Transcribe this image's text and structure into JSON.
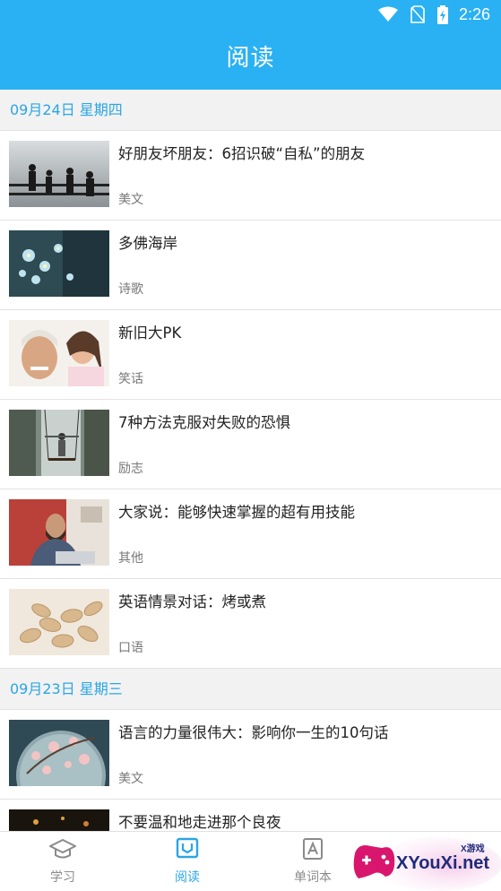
{
  "status_bar": {
    "time": "2:26",
    "icons": [
      "wifi-icon",
      "no-sim-icon",
      "battery-charging-icon"
    ]
  },
  "header": {
    "title": "阅读"
  },
  "sections": [
    {
      "date": "09月24日 星期四",
      "items": [
        {
          "title": "好朋友坏朋友：6招识破“自私”的朋友",
          "category": "美文",
          "thumb": "friends-silhouette-image"
        },
        {
          "title": "多佛海岸",
          "category": "诗歌",
          "thumb": "flowers-image"
        },
        {
          "title": "新旧大PK",
          "category": "笑话",
          "thumb": "grandfather-child-image"
        },
        {
          "title": "7种方法克服对失败的恐惧",
          "category": "励志",
          "thumb": "swing-waterfall-image"
        },
        {
          "title": "大家说：能够快速掌握的超有用技能",
          "category": "其他",
          "thumb": "man-laptop-image"
        },
        {
          "title": "英语情景对话：烤或煮",
          "category": "口语",
          "thumb": "peanuts-image"
        }
      ]
    },
    {
      "date": "09月23日 星期三",
      "items": [
        {
          "title": "语言的力量很伟大：影响你一生的10句话",
          "category": "美文",
          "thumb": "cherry-blossom-image"
        },
        {
          "title": "不要温和地走进那个良夜",
          "category": "",
          "thumb": "night-image"
        }
      ]
    }
  ],
  "bottom_nav": {
    "tabs": [
      {
        "label": "学习",
        "icon": "graduation-cap-icon",
        "active": false
      },
      {
        "label": "阅读",
        "icon": "book-icon",
        "active": true
      },
      {
        "label": "单词本",
        "icon": "word-book-icon",
        "active": false
      }
    ]
  },
  "watermark": {
    "text": "XYouXi.net",
    "small": "X游戏"
  },
  "colors": {
    "primary": "#2ab1f3",
    "accent_text": "#2aa6e4",
    "background": "#f2f2f2"
  }
}
